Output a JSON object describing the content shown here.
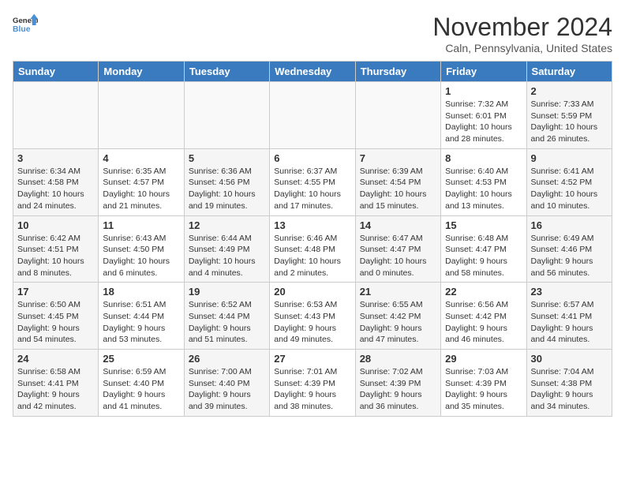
{
  "header": {
    "logo_line1": "General",
    "logo_line2": "Blue",
    "month": "November 2024",
    "location": "Caln, Pennsylvania, United States"
  },
  "weekdays": [
    "Sunday",
    "Monday",
    "Tuesday",
    "Wednesday",
    "Thursday",
    "Friday",
    "Saturday"
  ],
  "weeks": [
    [
      {
        "day": "",
        "info": ""
      },
      {
        "day": "",
        "info": ""
      },
      {
        "day": "",
        "info": ""
      },
      {
        "day": "",
        "info": ""
      },
      {
        "day": "",
        "info": ""
      },
      {
        "day": "1",
        "info": "Sunrise: 7:32 AM\nSunset: 6:01 PM\nDaylight: 10 hours\nand 28 minutes."
      },
      {
        "day": "2",
        "info": "Sunrise: 7:33 AM\nSunset: 5:59 PM\nDaylight: 10 hours\nand 26 minutes."
      }
    ],
    [
      {
        "day": "3",
        "info": "Sunrise: 6:34 AM\nSunset: 4:58 PM\nDaylight: 10 hours\nand 24 minutes."
      },
      {
        "day": "4",
        "info": "Sunrise: 6:35 AM\nSunset: 4:57 PM\nDaylight: 10 hours\nand 21 minutes."
      },
      {
        "day": "5",
        "info": "Sunrise: 6:36 AM\nSunset: 4:56 PM\nDaylight: 10 hours\nand 19 minutes."
      },
      {
        "day": "6",
        "info": "Sunrise: 6:37 AM\nSunset: 4:55 PM\nDaylight: 10 hours\nand 17 minutes."
      },
      {
        "day": "7",
        "info": "Sunrise: 6:39 AM\nSunset: 4:54 PM\nDaylight: 10 hours\nand 15 minutes."
      },
      {
        "day": "8",
        "info": "Sunrise: 6:40 AM\nSunset: 4:53 PM\nDaylight: 10 hours\nand 13 minutes."
      },
      {
        "day": "9",
        "info": "Sunrise: 6:41 AM\nSunset: 4:52 PM\nDaylight: 10 hours\nand 10 minutes."
      }
    ],
    [
      {
        "day": "10",
        "info": "Sunrise: 6:42 AM\nSunset: 4:51 PM\nDaylight: 10 hours\nand 8 minutes."
      },
      {
        "day": "11",
        "info": "Sunrise: 6:43 AM\nSunset: 4:50 PM\nDaylight: 10 hours\nand 6 minutes."
      },
      {
        "day": "12",
        "info": "Sunrise: 6:44 AM\nSunset: 4:49 PM\nDaylight: 10 hours\nand 4 minutes."
      },
      {
        "day": "13",
        "info": "Sunrise: 6:46 AM\nSunset: 4:48 PM\nDaylight: 10 hours\nand 2 minutes."
      },
      {
        "day": "14",
        "info": "Sunrise: 6:47 AM\nSunset: 4:47 PM\nDaylight: 10 hours\nand 0 minutes."
      },
      {
        "day": "15",
        "info": "Sunrise: 6:48 AM\nSunset: 4:47 PM\nDaylight: 9 hours\nand 58 minutes."
      },
      {
        "day": "16",
        "info": "Sunrise: 6:49 AM\nSunset: 4:46 PM\nDaylight: 9 hours\nand 56 minutes."
      }
    ],
    [
      {
        "day": "17",
        "info": "Sunrise: 6:50 AM\nSunset: 4:45 PM\nDaylight: 9 hours\nand 54 minutes."
      },
      {
        "day": "18",
        "info": "Sunrise: 6:51 AM\nSunset: 4:44 PM\nDaylight: 9 hours\nand 53 minutes."
      },
      {
        "day": "19",
        "info": "Sunrise: 6:52 AM\nSunset: 4:44 PM\nDaylight: 9 hours\nand 51 minutes."
      },
      {
        "day": "20",
        "info": "Sunrise: 6:53 AM\nSunset: 4:43 PM\nDaylight: 9 hours\nand 49 minutes."
      },
      {
        "day": "21",
        "info": "Sunrise: 6:55 AM\nSunset: 4:42 PM\nDaylight: 9 hours\nand 47 minutes."
      },
      {
        "day": "22",
        "info": "Sunrise: 6:56 AM\nSunset: 4:42 PM\nDaylight: 9 hours\nand 46 minutes."
      },
      {
        "day": "23",
        "info": "Sunrise: 6:57 AM\nSunset: 4:41 PM\nDaylight: 9 hours\nand 44 minutes."
      }
    ],
    [
      {
        "day": "24",
        "info": "Sunrise: 6:58 AM\nSunset: 4:41 PM\nDaylight: 9 hours\nand 42 minutes."
      },
      {
        "day": "25",
        "info": "Sunrise: 6:59 AM\nSunset: 4:40 PM\nDaylight: 9 hours\nand 41 minutes."
      },
      {
        "day": "26",
        "info": "Sunrise: 7:00 AM\nSunset: 4:40 PM\nDaylight: 9 hours\nand 39 minutes."
      },
      {
        "day": "27",
        "info": "Sunrise: 7:01 AM\nSunset: 4:39 PM\nDaylight: 9 hours\nand 38 minutes."
      },
      {
        "day": "28",
        "info": "Sunrise: 7:02 AM\nSunset: 4:39 PM\nDaylight: 9 hours\nand 36 minutes."
      },
      {
        "day": "29",
        "info": "Sunrise: 7:03 AM\nSunset: 4:39 PM\nDaylight: 9 hours\nand 35 minutes."
      },
      {
        "day": "30",
        "info": "Sunrise: 7:04 AM\nSunset: 4:38 PM\nDaylight: 9 hours\nand 34 minutes."
      }
    ]
  ]
}
